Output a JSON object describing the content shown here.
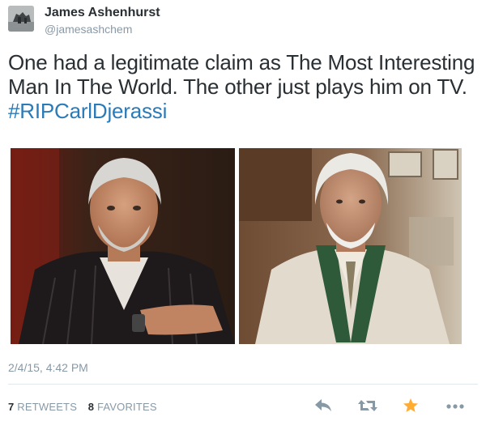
{
  "user": {
    "display_name": "James Ashenhurst",
    "handle": "@jamesashchem",
    "avatar_icon": "profile-photo"
  },
  "tweet": {
    "text": "One had a legitimate claim as The Most Interesting Man In The World. The other just plays him on TV.",
    "hashtag": "#RIPCarlDjerassi",
    "hashtag_color": "#2b7bb9"
  },
  "photos": [
    {
      "subject": "man with white beard in dark pinstripe jacket"
    },
    {
      "subject": "elderly man with white hair and beard in light suit with green ribbon"
    }
  ],
  "meta": {
    "timestamp": "2/4/15, 4:42 PM"
  },
  "stats": {
    "retweets_count": "7",
    "retweets_label": "RETWEETS",
    "favorites_count": "8",
    "favorites_label": "FAVORITES"
  },
  "actions": {
    "reply_icon": "reply-icon",
    "retweet_icon": "retweet-icon",
    "favorite_icon": "star-icon",
    "favorite_color": "#ffac33",
    "more_icon": "more-dots-icon",
    "icon_color": "#8899a6"
  }
}
